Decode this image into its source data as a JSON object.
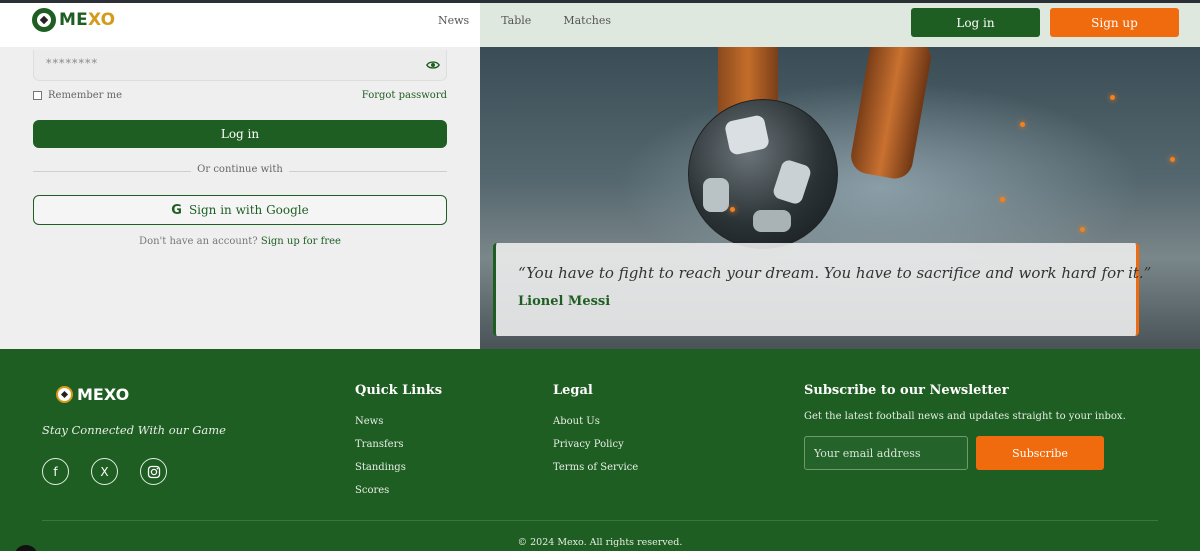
{
  "brand": {
    "name_part1": "ME",
    "name_part2": "XO"
  },
  "nav": {
    "items": [
      "News",
      "Table",
      "Matches"
    ]
  },
  "header": {
    "login_label": "Log in",
    "signup_label": "Sign up"
  },
  "form": {
    "password_mask": "********",
    "remember_label": "Remember me",
    "forgot_label": "Forgot password",
    "login_label": "Log in",
    "divider_text": "Or continue with",
    "google_label": "Sign in with Google",
    "signup_prompt": "Don't have an account?",
    "signup_link": "Sign up for free"
  },
  "hero": {
    "quote": "“You have to fight to reach your dream. You have to sacrifice and work hard for it.”",
    "author": "Lionel Messi"
  },
  "footer": {
    "brand": "MEXO",
    "tagline": "Stay Connected With our Game",
    "socials": [
      "facebook-icon",
      "x-icon",
      "instagram-icon"
    ],
    "quick_links": {
      "title": "Quick Links",
      "items": [
        "News",
        "Transfers",
        "Standings",
        "Scores"
      ]
    },
    "legal": {
      "title": "Legal",
      "items": [
        "About Us",
        "Privacy Policy",
        "Terms of Service"
      ]
    },
    "newsletter": {
      "title": "Subscribe to our Newsletter",
      "description": "Get the latest football news and updates straight to your inbox.",
      "placeholder": "Your email address",
      "button": "Subscribe"
    },
    "copyright": "© 2024 Mexo. All rights reserved."
  },
  "colors": {
    "primary": "#1f5e22",
    "accent": "#f06a0e",
    "logo_gold": "#d69a1a"
  }
}
